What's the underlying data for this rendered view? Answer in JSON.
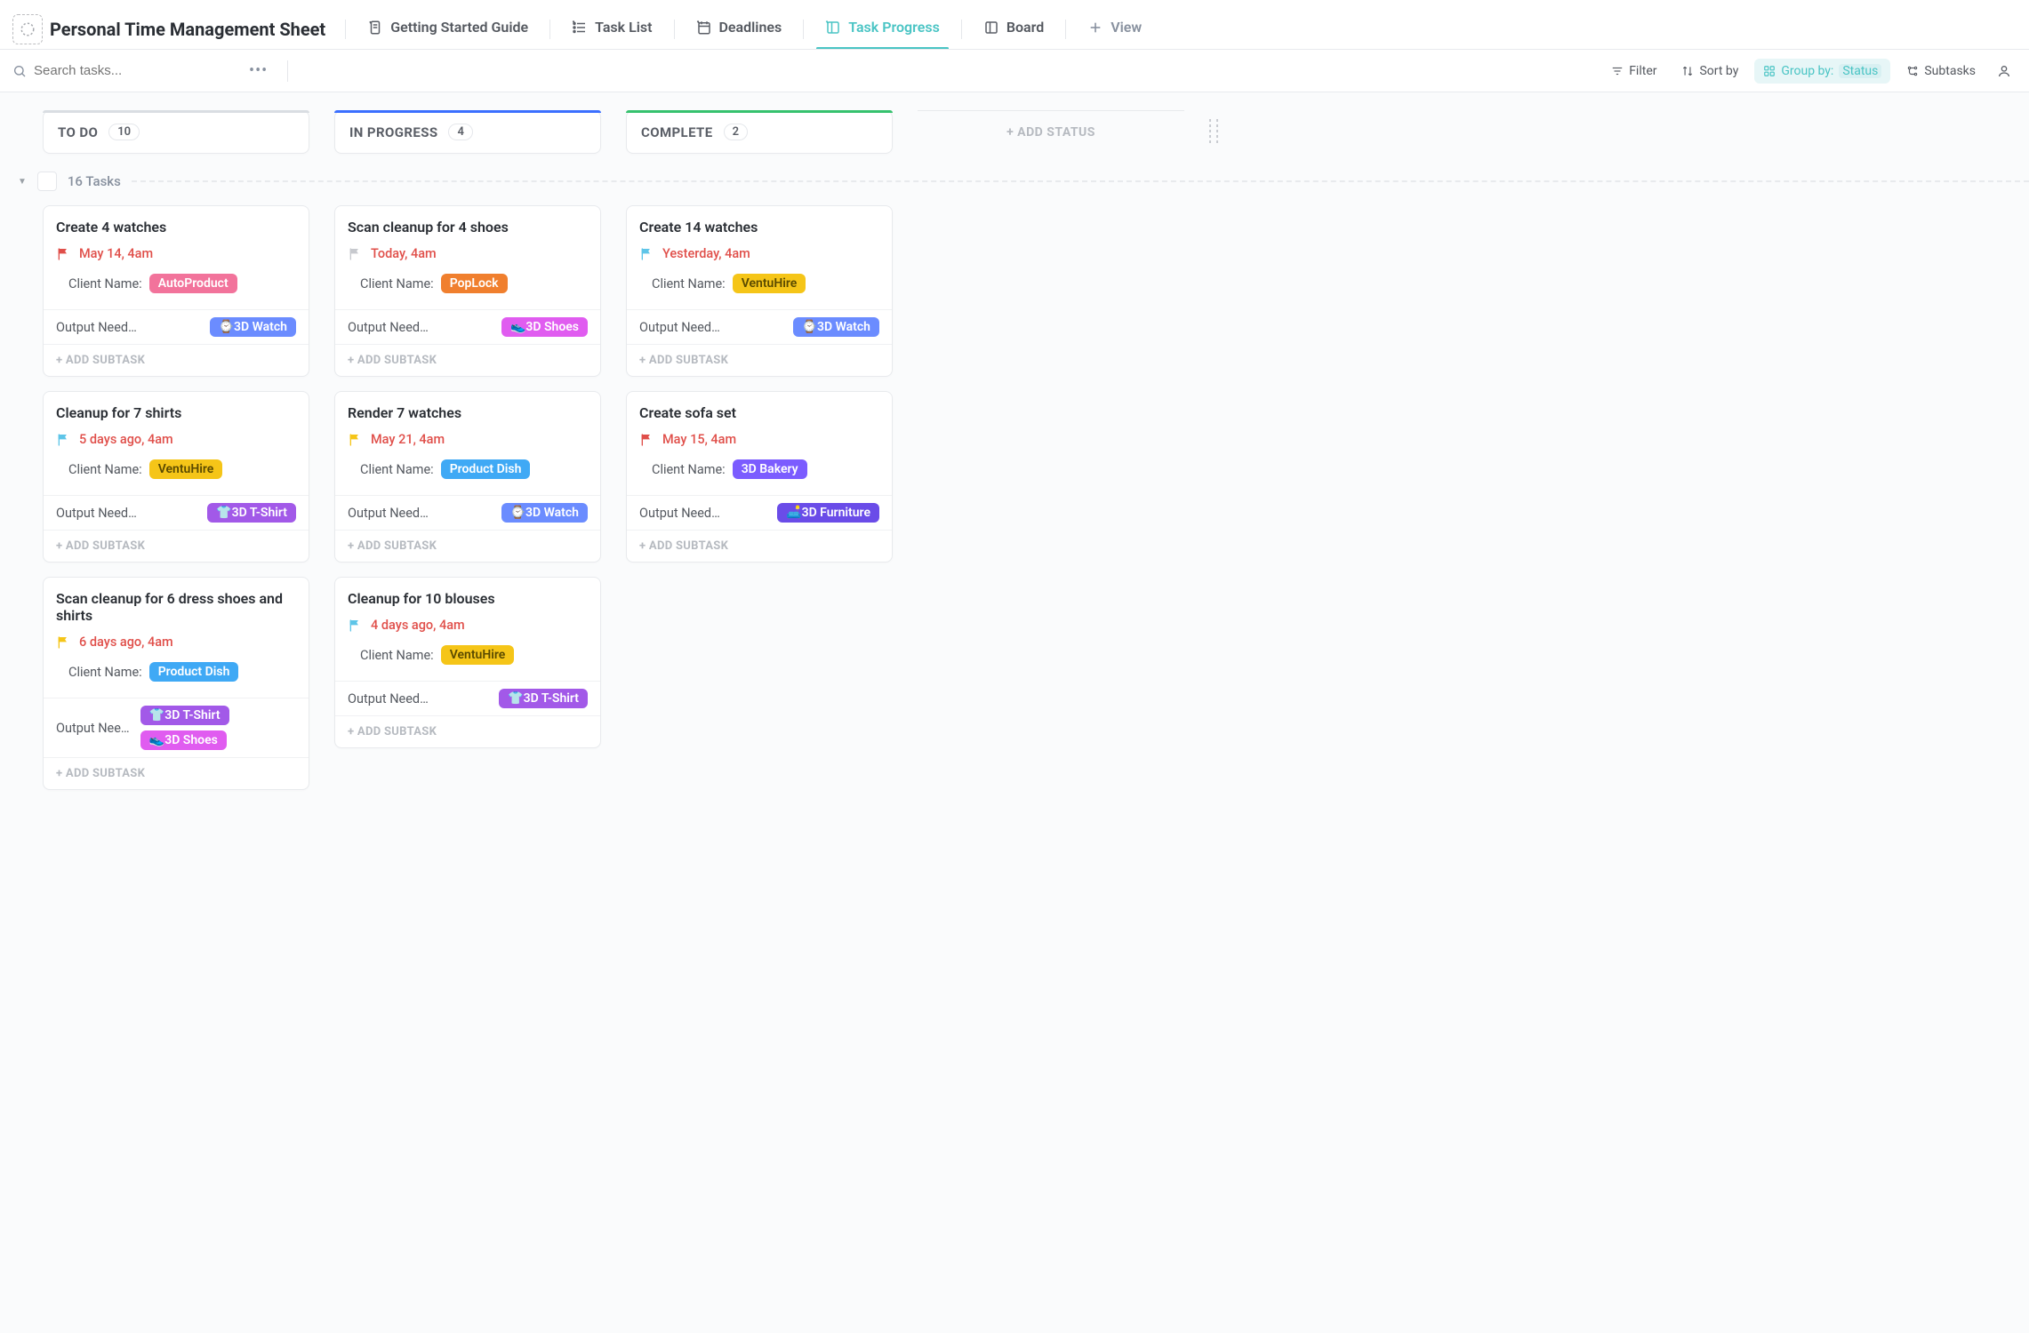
{
  "header": {
    "title": "Personal Time Management Sheet",
    "tabs": [
      {
        "id": "guide",
        "label": "Getting Started Guide",
        "icon": "doc"
      },
      {
        "id": "tasklist",
        "label": "Task List",
        "icon": "list"
      },
      {
        "id": "deadlines",
        "label": "Deadlines",
        "icon": "calendar"
      },
      {
        "id": "progress",
        "label": "Task Progress",
        "icon": "board",
        "active": true
      },
      {
        "id": "board",
        "label": "Board",
        "icon": "board2"
      }
    ],
    "add_view_label": "View"
  },
  "toolbar": {
    "search_placeholder": "Search tasks...",
    "filter_label": "Filter",
    "sort_label": "Sort by",
    "group_label": "Group by:",
    "group_value": "Status",
    "subtasks_label": "Subtasks"
  },
  "board": {
    "add_status_label": "+ ADD STATUS",
    "columns": [
      {
        "id": "todo",
        "name": "TO DO",
        "count": 10,
        "bar": "#d9dde2"
      },
      {
        "id": "inprogress",
        "name": "IN PROGRESS",
        "count": 4,
        "bar": "#3b6fff"
      },
      {
        "id": "complete",
        "name": "COMPLETE",
        "count": 2,
        "bar": "#36c26e"
      }
    ],
    "group": {
      "label": "16 Tasks"
    },
    "fields": {
      "client_label": "Client Name:",
      "output_label": "Output Needed:",
      "add_subtask_label": "+ ADD SUBTASK"
    },
    "cards": {
      "todo": [
        {
          "title": "Create 4 watches",
          "flag": "red",
          "due": "May 14, 4am",
          "client": {
            "text": "AutoProduct",
            "cls": "t-autoproduct"
          },
          "outputs": [
            {
              "text": "⌚3D Watch",
              "cls": "t-3dwatch"
            }
          ]
        },
        {
          "title": "Cleanup for 7 shirts",
          "flag": "cyan",
          "due": "5 days ago, 4am",
          "client": {
            "text": "VentuHire",
            "cls": "t-ventuhire"
          },
          "outputs": [
            {
              "text": "👕3D T-Shirt",
              "cls": "t-3dtshirt"
            }
          ]
        },
        {
          "title": "Scan cleanup for 6 dress shoes and shirts",
          "flag": "yellow",
          "due": "6 days ago, 4am",
          "client": {
            "text": "Product Dish",
            "cls": "t-productdish"
          },
          "outputs": [
            {
              "text": "👕3D T-Shirt",
              "cls": "t-3dtshirt"
            },
            {
              "text": "👟3D Shoes",
              "cls": "t-3dshoes"
            }
          ]
        }
      ],
      "inprogress": [
        {
          "title": "Scan cleanup for 4 shoes",
          "flag": "grey",
          "due": "Today, 4am",
          "client": {
            "text": "PopLock",
            "cls": "t-poplock"
          },
          "outputs": [
            {
              "text": "👟3D Shoes",
              "cls": "t-3dshoes"
            }
          ]
        },
        {
          "title": "Render 7 watches",
          "flag": "yellow",
          "due": "May 21, 4am",
          "client": {
            "text": "Product Dish",
            "cls": "t-productdish"
          },
          "outputs": [
            {
              "text": "⌚3D Watch",
              "cls": "t-3dwatch"
            }
          ]
        },
        {
          "title": "Cleanup for 10 blouses",
          "flag": "cyan",
          "due": "4 days ago, 4am",
          "client": {
            "text": "VentuHire",
            "cls": "t-ventuhire"
          },
          "outputs": [
            {
              "text": "👕3D T-Shirt",
              "cls": "t-3dtshirt"
            }
          ]
        }
      ],
      "complete": [
        {
          "title": "Create 14 watches",
          "flag": "cyan",
          "due": "Yesterday, 4am",
          "client": {
            "text": "VentuHire",
            "cls": "t-ventuhire"
          },
          "outputs": [
            {
              "text": "⌚3D Watch",
              "cls": "t-3dwatch"
            }
          ]
        },
        {
          "title": "Create sofa set",
          "flag": "red",
          "due": "May 15, 4am",
          "client": {
            "text": "3D Bakery",
            "cls": "t-3dbakery"
          },
          "outputs": [
            {
              "text": "🛋️3D Furniture",
              "cls": "t-3dfurniture"
            }
          ]
        }
      ]
    }
  },
  "flag_colors": {
    "red": "#e04f4a",
    "cyan": "#5ec5e8",
    "yellow": "#f5c518",
    "grey": "#c7c9ce"
  }
}
